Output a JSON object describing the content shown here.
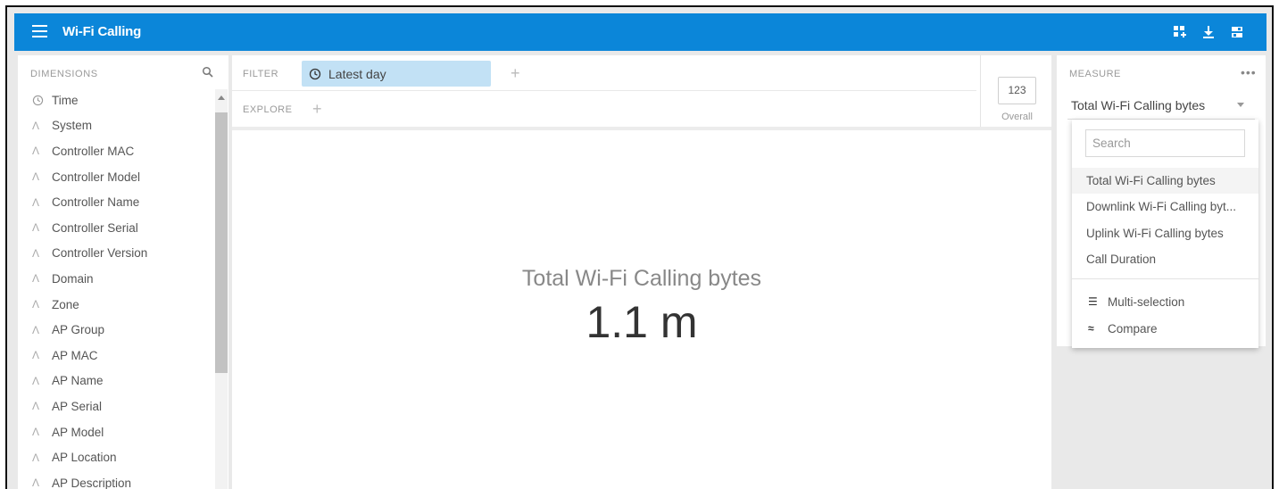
{
  "header": {
    "title": "Wi-Fi Calling",
    "brand_color": "#0b86d9",
    "icons": [
      "add-tile-icon",
      "download-icon",
      "settings-panel-icon"
    ]
  },
  "dimensions": {
    "label": "DIMENSIONS",
    "items": [
      {
        "icon": "clock-icon",
        "label": "Time"
      },
      {
        "icon": "string-icon",
        "label": "System"
      },
      {
        "icon": "string-icon",
        "label": "Controller MAC"
      },
      {
        "icon": "string-icon",
        "label": "Controller Model"
      },
      {
        "icon": "string-icon",
        "label": "Controller Name"
      },
      {
        "icon": "string-icon",
        "label": "Controller Serial"
      },
      {
        "icon": "string-icon",
        "label": "Controller Version"
      },
      {
        "icon": "string-icon",
        "label": "Domain"
      },
      {
        "icon": "string-icon",
        "label": "Zone"
      },
      {
        "icon": "string-icon",
        "label": "AP Group"
      },
      {
        "icon": "string-icon",
        "label": "AP MAC"
      },
      {
        "icon": "string-icon",
        "label": "AP Name"
      },
      {
        "icon": "string-icon",
        "label": "AP Serial"
      },
      {
        "icon": "string-icon",
        "label": "AP Model"
      },
      {
        "icon": "string-icon",
        "label": "AP Location"
      },
      {
        "icon": "string-icon",
        "label": "AP Description"
      }
    ]
  },
  "filter": {
    "label": "FILTER",
    "chip": "Latest day",
    "chip_color": "#c2e1f5"
  },
  "explore": {
    "label": "EXPLORE"
  },
  "visualization": {
    "value": "123",
    "label": "Overall"
  },
  "main": {
    "metric_title": "Total Wi-Fi Calling bytes",
    "metric_value": "1.1 m"
  },
  "measure": {
    "label": "MEASURE",
    "selected": "Total Wi-Fi Calling bytes",
    "dropdown": {
      "search_placeholder": "Search",
      "options": [
        "Total Wi-Fi Calling bytes",
        "Downlink Wi-Fi Calling byt...",
        "Uplink Wi-Fi Calling bytes",
        "Call Duration"
      ],
      "actions": [
        {
          "icon": "list-icon",
          "label": "Multi-selection"
        },
        {
          "icon": "compare-icon",
          "label": "Compare"
        }
      ]
    }
  }
}
